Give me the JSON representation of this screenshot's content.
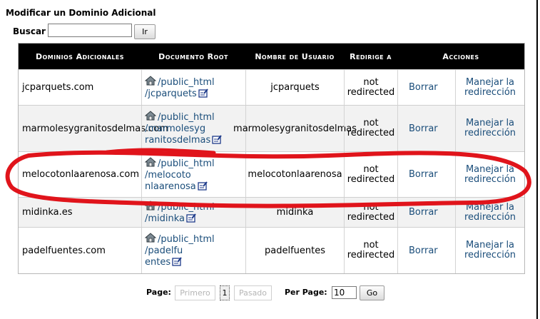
{
  "page": {
    "title": "Modificar un Dominio Adicional",
    "search_label": "Buscar",
    "search_value": "",
    "search_button": "Ir"
  },
  "table": {
    "headers": [
      "Dominios Adicionales",
      "Documento Root",
      "Nombre de Usuario",
      "Redirige a",
      "Acciones"
    ],
    "rows": [
      {
        "domain": "jcparquets.com",
        "root_lines": [
          "/public_html",
          "/jcparquets"
        ],
        "user": "jcparquets",
        "redirect": "not redirected",
        "delete": "Borrar",
        "manage": "Manejar la redirección"
      },
      {
        "domain": "marmolesygranitosdelmas.com",
        "root_lines": [
          "/public_html",
          "/marmolesyg",
          "ranitosdelmas"
        ],
        "user": "marmolesygranitosdelmas",
        "redirect": "not redirected",
        "delete": "Borrar",
        "manage": "Manejar la redirección"
      },
      {
        "domain": "melocotonlaarenosa.com",
        "root_lines": [
          "/public_html",
          "/melocoto",
          "nlaarenosa"
        ],
        "user": "melocotonlaarenosa",
        "redirect": "not redirected",
        "delete": "Borrar",
        "manage": "Manejar la redirección"
      },
      {
        "domain": "midinka.es",
        "root_lines": [
          "/public_html",
          "/midinka"
        ],
        "user": "midinka",
        "redirect": "not redirected",
        "delete": "Borrar",
        "manage": "Manejar la redirección"
      },
      {
        "domain": "padelfuentes.com",
        "root_lines": [
          "/public_html",
          "/padelfu",
          "entes"
        ],
        "user": "padelfuentes",
        "redirect": "not redirected",
        "delete": "Borrar",
        "manage": "Manejar la redirección"
      }
    ]
  },
  "pagination": {
    "label": "Page:",
    "first": "Primero",
    "current": "1",
    "last": "Pasado",
    "per_page_label": "Per Page:",
    "per_page_value": "10",
    "go": "Go"
  },
  "annotation": {
    "color": "#e0141b",
    "shape": "hand-drawn circle around melocotonlaarenosa.com row"
  },
  "icons": {
    "home": "home-folder-icon",
    "edit": "edit-icon"
  }
}
